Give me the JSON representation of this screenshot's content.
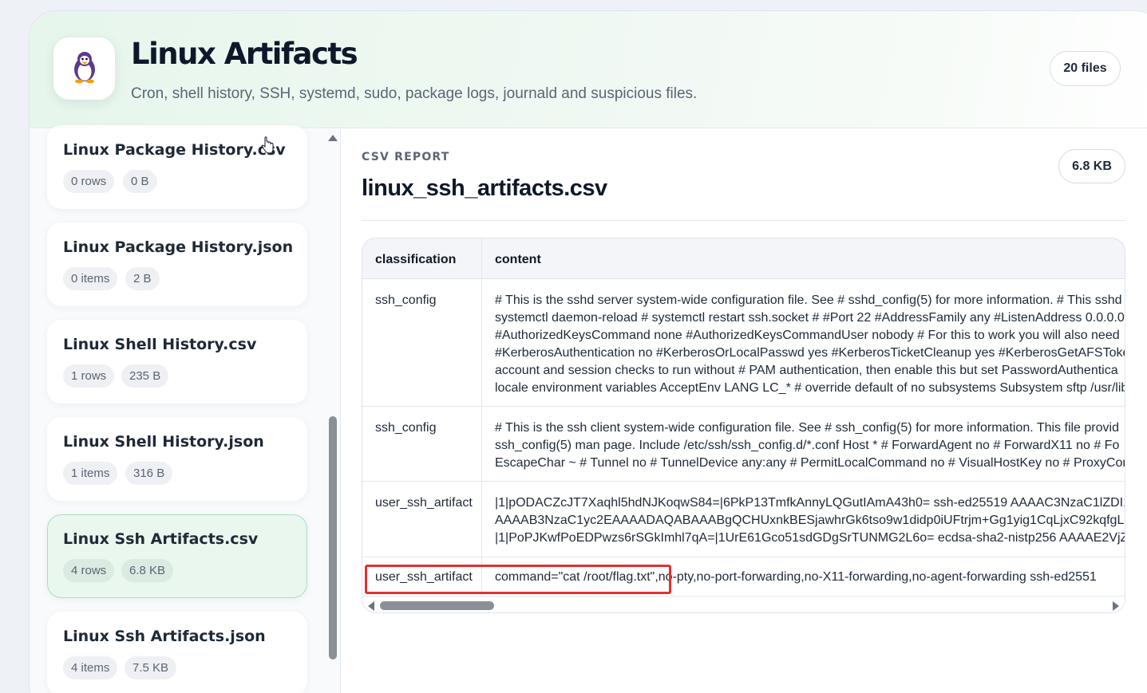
{
  "header": {
    "logo_icon": "penguin-icon",
    "title": "Linux Artifacts",
    "subtitle": "Cron, shell history, SSH, systemd, sudo, package logs, journald and suspicious files.",
    "file_count": "20 files"
  },
  "sidebar": {
    "files": [
      {
        "name": "Linux Package History.csv",
        "count": "0 rows",
        "size": "0 B",
        "active": false
      },
      {
        "name": "Linux Package History.json",
        "count": "0 items",
        "size": "2 B",
        "active": false
      },
      {
        "name": "Linux Shell History.csv",
        "count": "1 rows",
        "size": "235 B",
        "active": false
      },
      {
        "name": "Linux Shell History.json",
        "count": "1 items",
        "size": "316 B",
        "active": false
      },
      {
        "name": "Linux Ssh Artifacts.csv",
        "count": "4 rows",
        "size": "6.8 KB",
        "active": true
      },
      {
        "name": "Linux Ssh Artifacts.json",
        "count": "4 items",
        "size": "7.5 KB",
        "active": false
      }
    ]
  },
  "report": {
    "kicker": "CSV REPORT",
    "title": "linux_ssh_artifacts.csv",
    "size": "6.8 KB",
    "columns": [
      "classification",
      "content"
    ],
    "rows": [
      {
        "classification": "ssh_config",
        "content_lines": [
          "# This is the sshd server system-wide configuration file. See # sshd_config(5) for more information. # This sshd",
          "systemctl daemon-reload # systemctl restart ssh.socket # #Port 22 #AddressFamily any #ListenAddress 0.0.0.0",
          "#AuthorizedKeysCommand none #AuthorizedKeysCommandUser nobody # For this to work you will also need",
          "#KerberosAuthentication no #KerberosOrLocalPasswd yes #KerberosTicketCleanup yes #KerberosGetAFSToken",
          "account and session checks to run without # PAM authentication, then enable this but set PasswordAuthentica",
          "locale environment variables AcceptEnv LANG LC_* # override default of no subsystems Subsystem sftp /usr/lib"
        ]
      },
      {
        "classification": "ssh_config",
        "content_lines": [
          "# This is the ssh client system-wide configuration file. See # ssh_config(5) for more information. This file provid",
          "ssh_config(5) man page. Include /etc/ssh/ssh_config.d/*.conf Host * # ForwardAgent no # ForwardX11 no # Fo",
          "EscapeChar ~ # Tunnel no # TunnelDevice any:any # PermitLocalCommand no # VisualHostKey no # ProxyCom"
        ]
      },
      {
        "classification": "user_ssh_artifact",
        "content_lines": [
          "|1|pODACZcJT7Xaqhl5hdNJKoqwS84=|6PkP13TmfkAnnyLQGutIAmA43h0= ssh-ed25519 AAAAC3NzaC1lZDI1N",
          "AAAAB3NzaC1yc2EAAAADAQABAAABgQCHUxnkBESjawhrGk6tso9w1didp0iUFtrjm+Gg1yig1CqLjxC92kqfgLBG",
          "|1|PoPJKwfPoEDPwzs6rSGkImhl7qA=|1UrE61Gco51sdGDgSrTUNMG2L6o= ecdsa-sha2-nistp256 AAAAE2VjZHN"
        ]
      },
      {
        "classification": "user_ssh_artifact",
        "content_lines": [
          "command=\"cat /root/flag.txt\",no-pty,no-port-forwarding,no-X11-forwarding,no-agent-forwarding ssh-ed2551"
        ]
      }
    ]
  },
  "colors": {
    "accent_green": "#e9f7ee",
    "highlight_red": "#e03131"
  }
}
